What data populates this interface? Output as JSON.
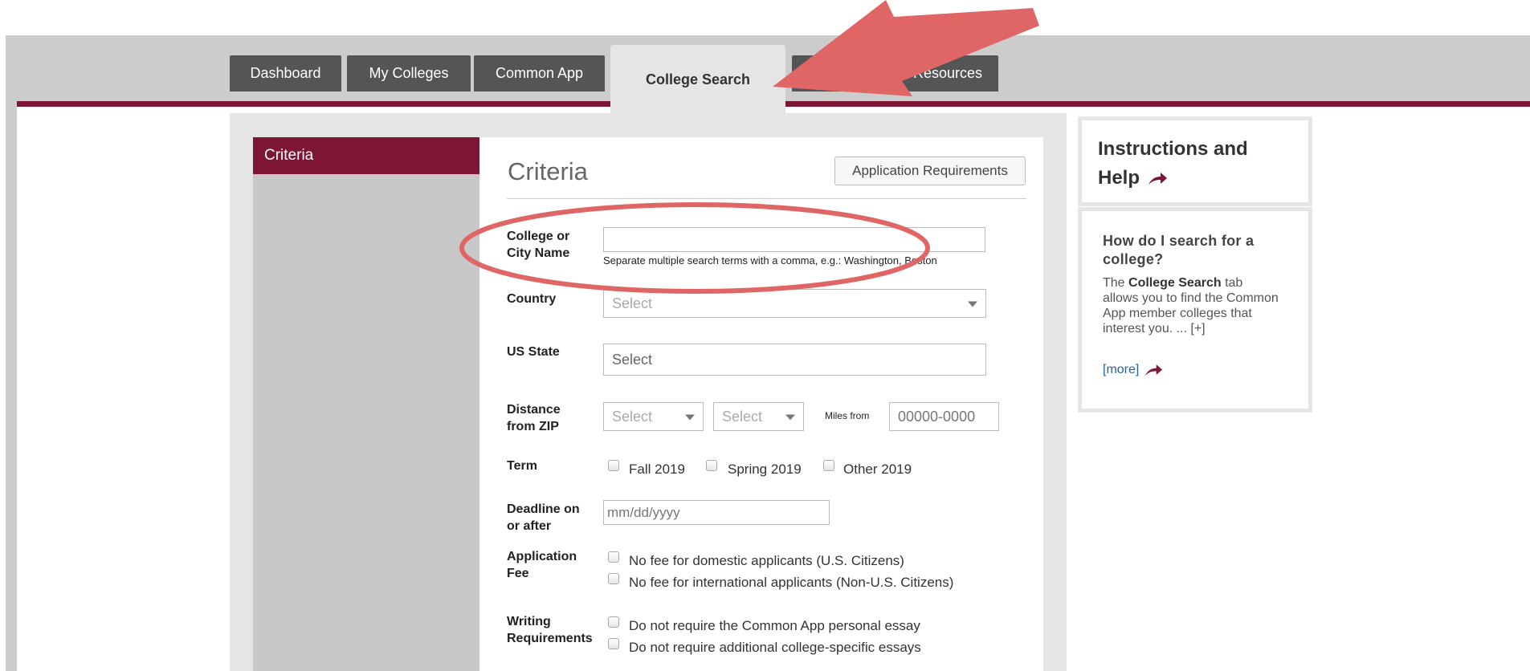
{
  "tabs": [
    {
      "label": "Dashboard"
    },
    {
      "label": "My Colleges"
    },
    {
      "label": "Common App"
    },
    {
      "label": "College Search",
      "active": true
    },
    {
      "label": "Resources"
    }
  ],
  "sidebar": {
    "items": [
      {
        "label": "Criteria",
        "active": true
      }
    ]
  },
  "form": {
    "title": "Criteria",
    "requirements_button": "Application Requirements",
    "college_name": {
      "label": "College or City Name",
      "value": "",
      "hint": "Separate multiple search terms with a comma, e.g.: Washington, Boston"
    },
    "country": {
      "label": "Country",
      "value": "Select"
    },
    "us_state": {
      "label": "US State",
      "value": "Select"
    },
    "distance": {
      "label": "Distance from ZIP",
      "select1": "Select",
      "select2": "Select",
      "miles_from": "Miles from",
      "zip_placeholder": "00000-0000"
    },
    "term": {
      "label": "Term",
      "options": [
        "Fall 2019",
        "Spring 2019",
        "Other 2019"
      ]
    },
    "deadline": {
      "label": "Deadline on or after",
      "placeholder": "mm/dd/yyyy"
    },
    "fee": {
      "label": "Application Fee",
      "options": [
        "No fee for domestic applicants (U.S. Citizens)",
        "No fee for international applicants (Non-U.S. Citizens)"
      ]
    },
    "writing": {
      "label": "Writing Requirements",
      "options": [
        "Do not require the Common App personal essay",
        "Do not require additional college-specific essays"
      ]
    }
  },
  "help": {
    "title": "Instructions and Help",
    "question": "How do I search for a college?",
    "text_before": "The ",
    "text_bold": "College Search",
    "text_after": " tab allows you to find the Common App member colleges that interest you. ... [+]",
    "more": "[more]"
  },
  "colors": {
    "brand": "#7d1535",
    "annotation": "#e06666"
  },
  "icons": [
    "arrow-right-icon",
    "select-caret-icon"
  ]
}
